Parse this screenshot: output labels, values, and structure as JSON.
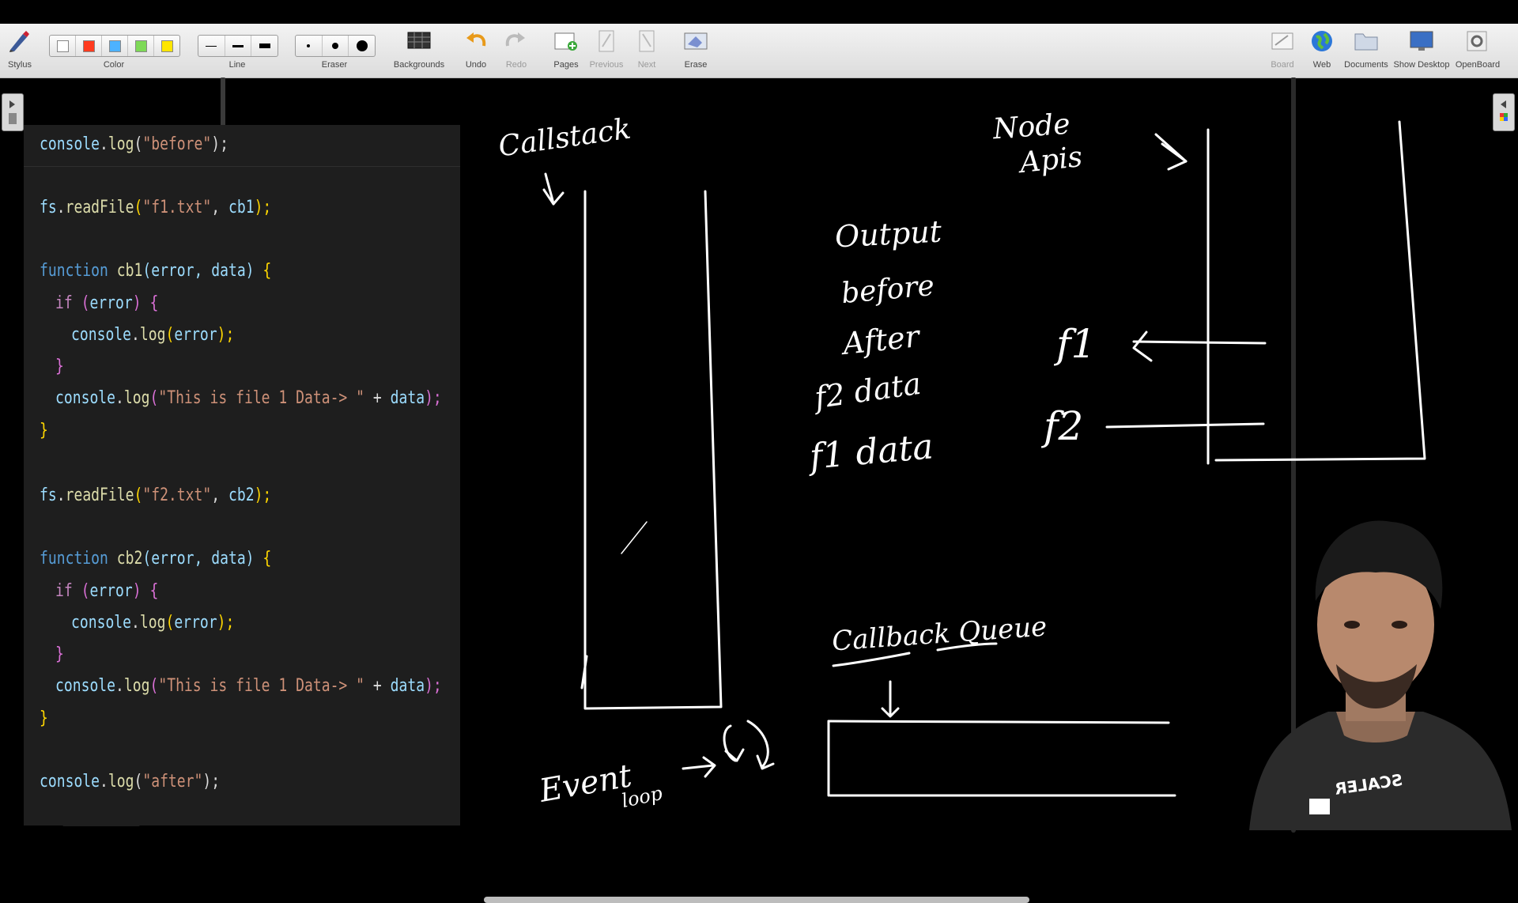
{
  "toolbar": {
    "stylus": "Stylus",
    "color": "Color",
    "line": "Line",
    "eraser": "Eraser",
    "backgrounds": "Backgrounds",
    "undo": "Undo",
    "redo": "Redo",
    "pages": "Pages",
    "previous": "Previous",
    "next": "Next",
    "erase": "Erase",
    "board": "Board",
    "web": "Web",
    "documents": "Documents",
    "show_desktop": "Show Desktop",
    "openboard": "OpenBoard",
    "colors": [
      "#ffffff",
      "#ff3b1f",
      "#4db2ff",
      "#7ed957",
      "#ffe600"
    ]
  },
  "code": {
    "l1": [
      "console",
      ".",
      "log",
      "(",
      "\"before\"",
      ");"
    ],
    "l2": [
      "fs",
      ".",
      "readFile",
      "(",
      "\"f1.txt\"",
      ", ",
      "cb1",
      ");"
    ],
    "l3": [
      "function",
      " ",
      "cb1",
      "(error, data) ",
      "{"
    ],
    "l4": [
      "if",
      " (",
      "error",
      ") ",
      "{"
    ],
    "l5": [
      "console",
      ".",
      "log",
      "(",
      "error",
      ");"
    ],
    "l6": [
      "}"
    ],
    "l7": [
      "console",
      ".",
      "log",
      "(",
      "\"This is file 1 Data-> \"",
      " + ",
      "data",
      ");"
    ],
    "l8": [
      "}"
    ],
    "l9": [
      "fs",
      ".",
      "readFile",
      "(",
      "\"f2.txt\"",
      ", ",
      "cb2",
      ");"
    ],
    "l10": [
      "function",
      " ",
      "cb2",
      "(error, data) ",
      "{"
    ],
    "l11": [
      "if",
      " (",
      "error",
      ") ",
      "{"
    ],
    "l12": [
      "console",
      ".",
      "log",
      "(",
      "error",
      ");"
    ],
    "l13": [
      "}"
    ],
    "l14": [
      "console",
      ".",
      "log",
      "(",
      "\"This is file 1 Data-> \"",
      " + ",
      "data",
      ");"
    ],
    "l15": [
      "}"
    ],
    "l16": [
      "console",
      ".",
      "log",
      "(",
      "\"after\"",
      ");"
    ]
  },
  "board": {
    "callstack": "Callstack",
    "node_apis_1": "Node",
    "node_apis_2": "Apis",
    "output": "Output",
    "out_1": "before",
    "out_2": "After",
    "out_3": "f2 data",
    "out_4": "f1 data",
    "f1": "f1",
    "f2": "f2",
    "callback_queue": "Callback Queue",
    "event_loop_1": "Event",
    "event_loop_2": "loop"
  },
  "presenter": {
    "shirt_text": "SCALER"
  }
}
